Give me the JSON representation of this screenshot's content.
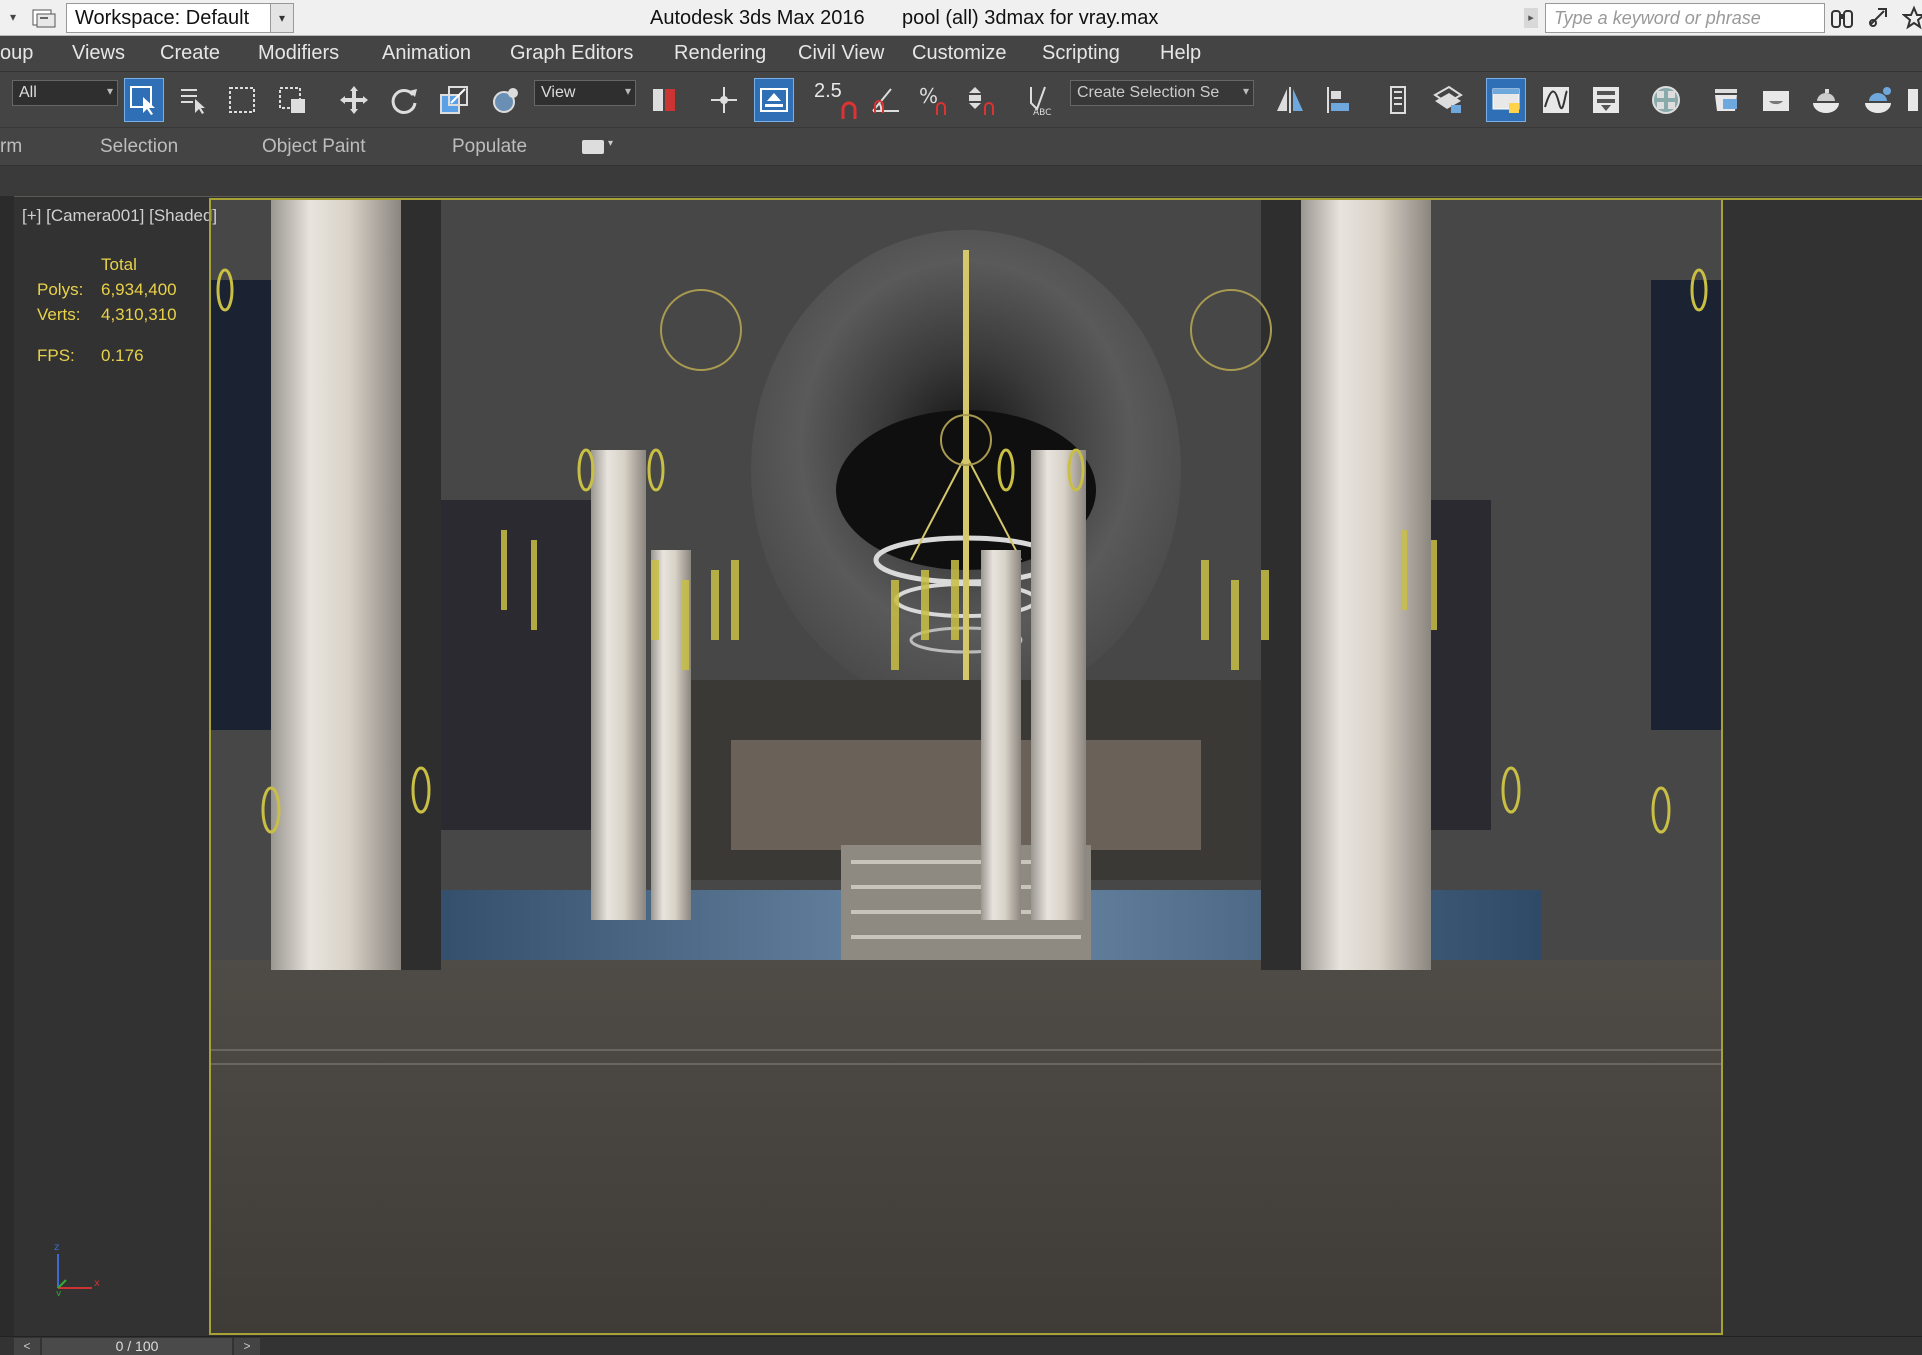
{
  "titlebar": {
    "workspace": "Workspace: Default",
    "app_title": "Autodesk 3ds Max 2016",
    "file_title": "pool (all) 3dmax for vray.max",
    "search_placeholder": "Type a keyword or phrase",
    "icons": [
      "quick-access-icon",
      "binoculars-icon",
      "sign-in-icon",
      "favorites-star-icon"
    ]
  },
  "menu": {
    "items": [
      "oup",
      "Views",
      "Create",
      "Modifiers",
      "Animation",
      "Graph Editors",
      "Rendering",
      "Civil View",
      "Customize",
      "Scripting",
      "Help"
    ]
  },
  "toolbar": {
    "filter_value": "All",
    "coord_value": "View",
    "angle_snap_label": "2.5",
    "selection_set_value": "Create Selection Se",
    "icons": [
      "select-object-icon",
      "select-by-name-icon",
      "rectangular-selection-icon",
      "window-crossing-icon",
      "select-move-icon",
      "select-rotate-icon",
      "select-scale-icon",
      "pivot-center-icon",
      "select-manipulate-icon",
      "keyboard-shortcut-icon",
      "snaps-toggle-icon",
      "angle-snap-icon",
      "percent-snap-icon",
      "spinner-snap-icon",
      "edit-named-sets-icon",
      "mirror-icon",
      "align-icon",
      "layer-manager-icon",
      "scene-explorer-icon",
      "ribbon-toggle-icon",
      "curve-editor-icon",
      "schematic-view-icon",
      "material-editor-icon",
      "render-setup-icon",
      "rendered-frame-icon",
      "render-icon",
      "render-iterative-icon"
    ]
  },
  "ribbon": {
    "tabs": [
      "rm",
      "Selection",
      "Object Paint",
      "Populate"
    ]
  },
  "viewport": {
    "label": "[+] [Camera001] [Shaded]",
    "stats": {
      "total_label": "Total",
      "polys_label": "Polys:",
      "polys_value": "6,934,400",
      "verts_label": "Verts:",
      "verts_value": "4,310,310",
      "fps_label": "FPS:",
      "fps_value": "0.176"
    },
    "colors": {
      "frame": "#a8a236",
      "stats_text": "#e8d24a"
    }
  },
  "timeline": {
    "frame_display": "0 / 100",
    "prev": "<",
    "next": ">"
  }
}
